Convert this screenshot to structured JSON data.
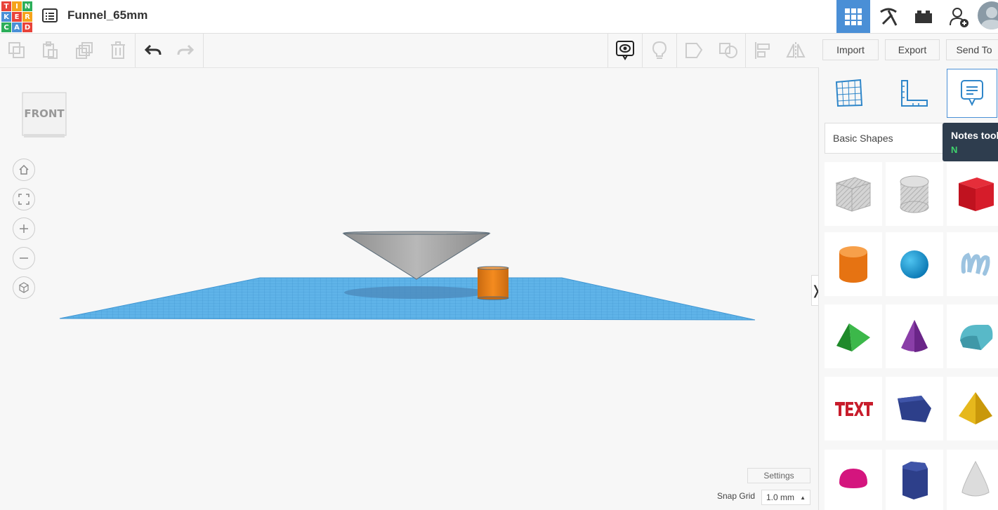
{
  "app": {
    "logo_letters": [
      "T",
      "I",
      "N",
      "K",
      "E",
      "R",
      "C",
      "A",
      "D"
    ],
    "document_title": "Funnel_65mm"
  },
  "top_nav": {
    "items": [
      {
        "name": "3d-design-grid-icon",
        "active": true
      },
      {
        "name": "pickaxe-icon",
        "active": false
      },
      {
        "name": "bricks-icon",
        "active": false
      },
      {
        "name": "add-user-icon",
        "active": false
      }
    ]
  },
  "toolbar": {
    "import_label": "Import",
    "export_label": "Export",
    "send_to_label": "Send To"
  },
  "viewcube": {
    "face_label": "FRONT"
  },
  "panel": {
    "tabs": [
      "workplane-grid-icon",
      "ruler-icon",
      "notes-icon"
    ],
    "active_tab": "notes-icon",
    "shapes_category": "Basic Shapes",
    "tooltip": {
      "title": "Notes tool",
      "shortcut": "N"
    },
    "shapes": [
      "box-hole",
      "cylinder-hole",
      "box",
      "cylinder",
      "sphere",
      "scribble",
      "roof",
      "cone",
      "round-roof",
      "text",
      "polygon-prism",
      "pyramid",
      "half-sphere",
      "hexagonal-prism",
      "paraboloid"
    ]
  },
  "canvas": {
    "settings_label": "Settings",
    "snap_grid_label": "Snap Grid",
    "snap_grid_value": "1.0 mm"
  },
  "colors": {
    "accent": "#4a8fd6",
    "workplane": "#5fb3e8",
    "logo": [
      "#e8433a",
      "#f5a31a",
      "#2cae5a",
      "#4a8fd6"
    ]
  }
}
